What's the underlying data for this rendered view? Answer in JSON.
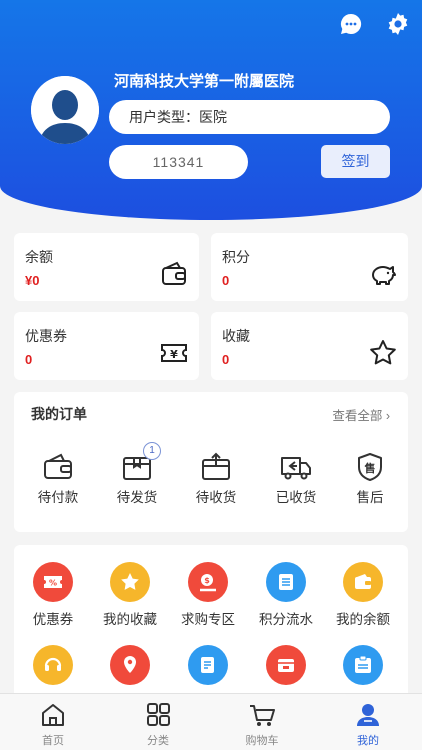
{
  "header": {
    "hospital_name": "河南科技大学第一附屬医院",
    "user_type": "用户类型：医院",
    "user_id": "113341",
    "signin_label": "签到"
  },
  "stats": [
    {
      "label": "余额",
      "value": "¥0",
      "icon": "wallet-icon"
    },
    {
      "label": "积分",
      "value": "0",
      "icon": "piggy-bank-icon"
    },
    {
      "label": "优惠券",
      "value": "0",
      "icon": "coupon-icon"
    },
    {
      "label": "收藏",
      "value": "0",
      "icon": "star-icon"
    }
  ],
  "orders": {
    "title": "我的订单",
    "view_all": "查看全部 ›",
    "items": [
      {
        "label": "待付款",
        "icon": "wallet-icon"
      },
      {
        "label": "待发货",
        "icon": "box-icon",
        "badge": "1"
      },
      {
        "label": "待收货",
        "icon": "package-icon"
      },
      {
        "label": "已收货",
        "icon": "truck-icon"
      },
      {
        "label": "售后",
        "icon": "after-sale-shield-icon"
      }
    ]
  },
  "tools": {
    "items": [
      {
        "label": "优惠券",
        "icon": "coupon-icon",
        "color": "#f04a3b"
      },
      {
        "label": "我的收藏",
        "icon": "star-icon",
        "color": "#f6b62b"
      },
      {
        "label": "求购专区",
        "icon": "request-icon",
        "color": "#f04a3b"
      },
      {
        "label": "积分流水",
        "icon": "list-icon",
        "color": "#2f9bf0"
      },
      {
        "label": "我的余额",
        "icon": "wallet-icon",
        "color": "#f6b62b"
      },
      {
        "label": "",
        "icon": "headset-icon",
        "color": "#f6b62b"
      },
      {
        "label": "",
        "icon": "location-icon",
        "color": "#f04a3b"
      },
      {
        "label": "",
        "icon": "document-icon",
        "color": "#2f9bf0"
      },
      {
        "label": "",
        "icon": "storefront-icon",
        "color": "#f04a3b"
      },
      {
        "label": "",
        "icon": "id-card-icon",
        "color": "#2f9bf0"
      }
    ]
  },
  "tabbar": [
    {
      "label": "首页",
      "icon": "home-icon",
      "active": false
    },
    {
      "label": "分类",
      "icon": "category-icon",
      "active": false
    },
    {
      "label": "购物车",
      "icon": "cart-icon",
      "active": false
    },
    {
      "label": "我的",
      "icon": "user-icon",
      "active": true
    }
  ],
  "colors": {
    "primary": "#1d5fe6",
    "price": "#e02020",
    "active_tab": "#2f63d8"
  }
}
